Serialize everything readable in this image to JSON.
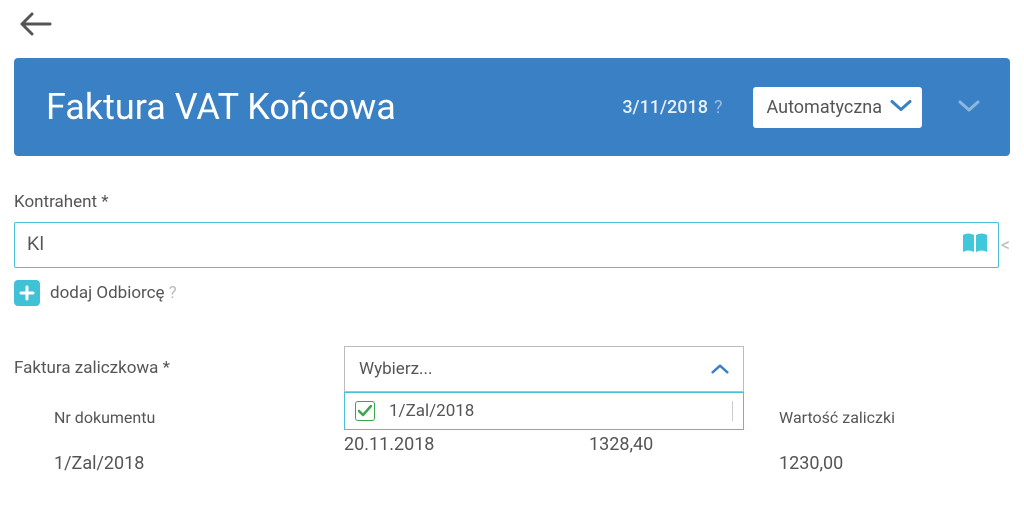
{
  "header": {
    "title": "Faktura VAT Końcowa",
    "date": "3/11/2018",
    "select_value": "Automatyczna"
  },
  "contractor": {
    "label": "Kontrahent *",
    "value": "Kl"
  },
  "add_recipient": {
    "label": "dodaj Odbiorcę"
  },
  "advance_invoice": {
    "label": "Faktura zaliczkowa *",
    "placeholder": "Wybierz...",
    "options": [
      {
        "label": "1/Zal/2018",
        "checked": true
      }
    ]
  },
  "table": {
    "headers": {
      "doc_number": "Nr dokumentu",
      "date": "",
      "gross": "",
      "advance_value": "Wartość zaliczki"
    },
    "row": {
      "doc_number": "1/Zal/2018",
      "date": "20.11.2018",
      "gross": "1328,40",
      "advance_value": "1230,00"
    }
  }
}
